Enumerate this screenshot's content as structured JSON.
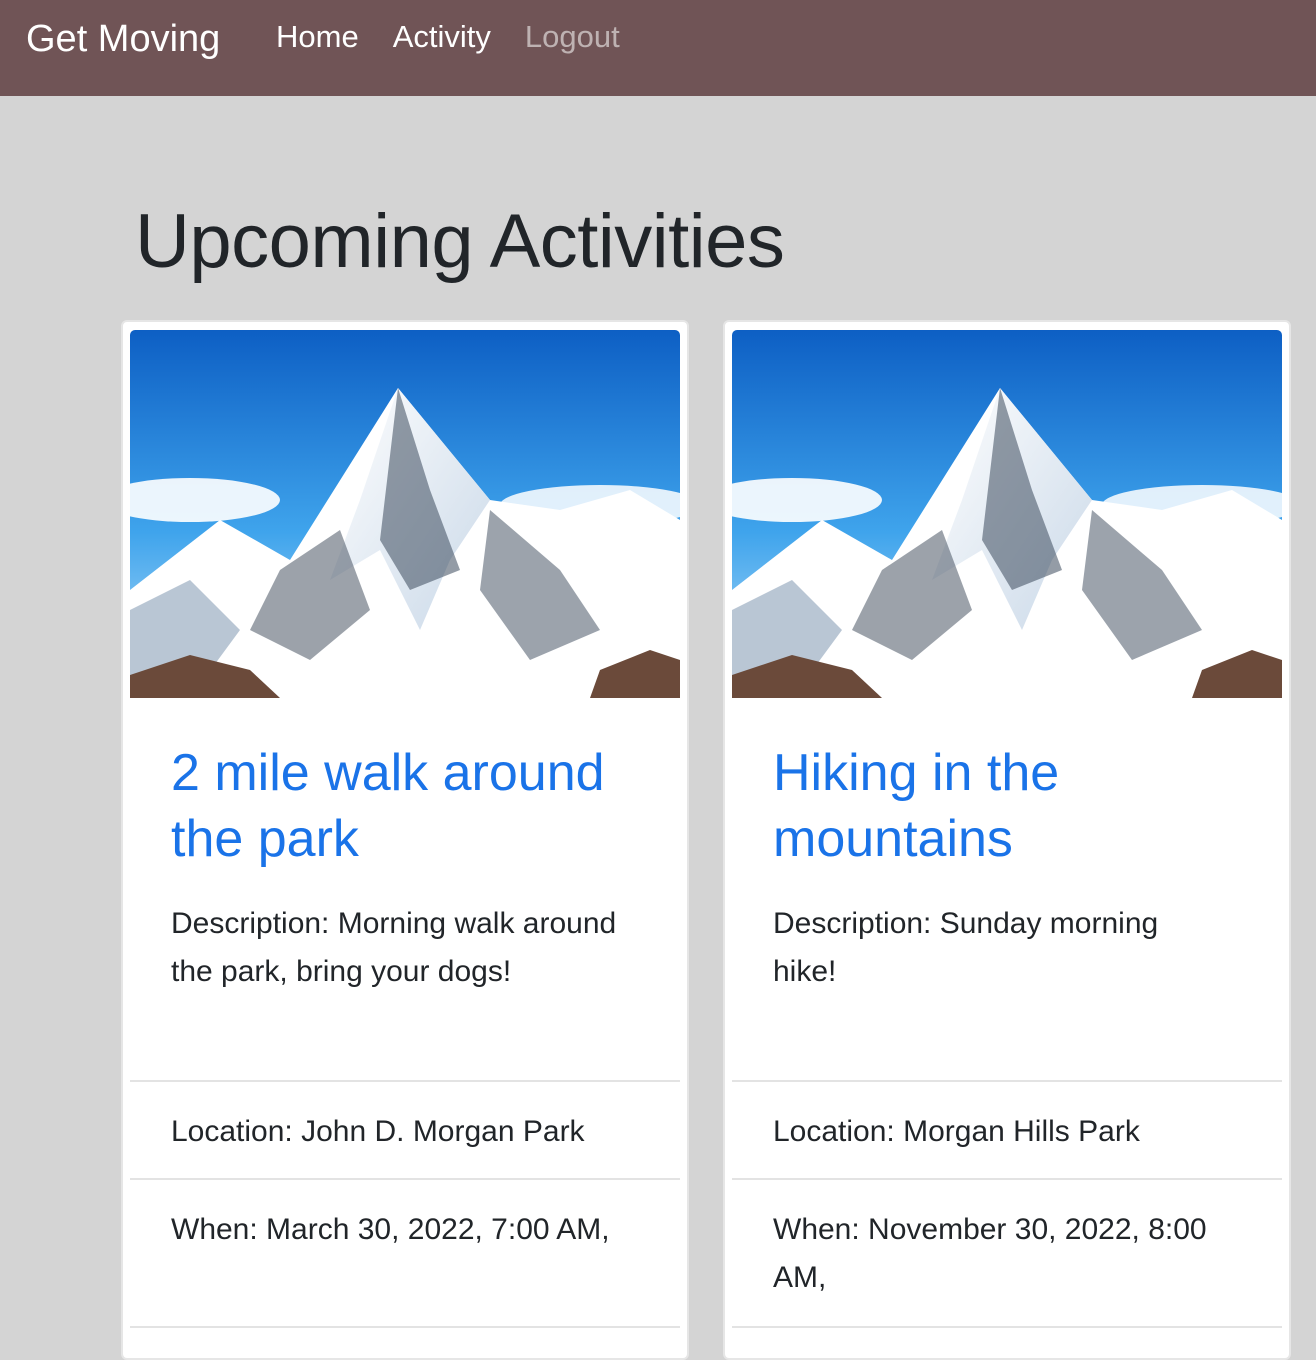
{
  "nav": {
    "brand": "Get Moving",
    "links": [
      "Home",
      "Activity",
      "Logout"
    ]
  },
  "page_title": "Upcoming Activities",
  "activities": [
    {
      "title": "2 mile walk around the park",
      "description": "Description: Morning walk around the park, bring your dogs!",
      "location": "Location: John D. Morgan Park",
      "when": "When: March 30, 2022, 7:00 AM,"
    },
    {
      "title": "Hiking in the mountains",
      "description": "Description: Sunday morning hike!",
      "location": "Location: Morgan Hills Park",
      "when": "When: November 30, 2022, 8:00 AM,"
    }
  ],
  "colors": {
    "navbar": "#705456",
    "background": "#d4d4d4",
    "link": "#1a73e8"
  }
}
